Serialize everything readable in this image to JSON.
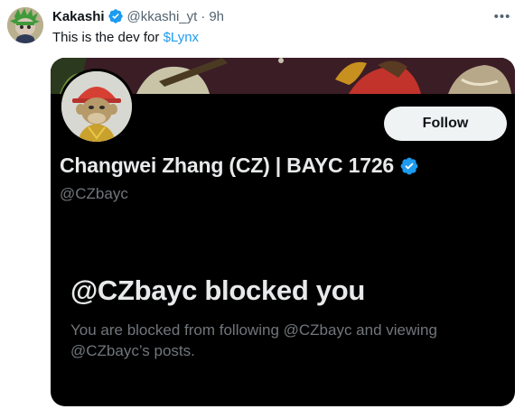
{
  "tweet": {
    "author_name": "Kakashi",
    "author_handle": "@kkashi_yt",
    "separator": "·",
    "time": "9h",
    "more_icon": "ellipsis-icon",
    "text_prefix": "This is the dev for ",
    "cashtag": "$Lynx"
  },
  "embedded_profile": {
    "follow_label": "Follow",
    "name": "Changwei Zhang (CZ) | BAYC 1726",
    "handle": "@CZbayc",
    "blocked_title": "@CZbayc blocked you",
    "blocked_description": "You are blocked from following @CZbayc and viewing @CZbayc’s posts."
  },
  "colors": {
    "accent": "#1d9bf0",
    "verified": "#1d9bf0",
    "card_background": "#000000",
    "follow_button_bg": "#eff3f4"
  }
}
